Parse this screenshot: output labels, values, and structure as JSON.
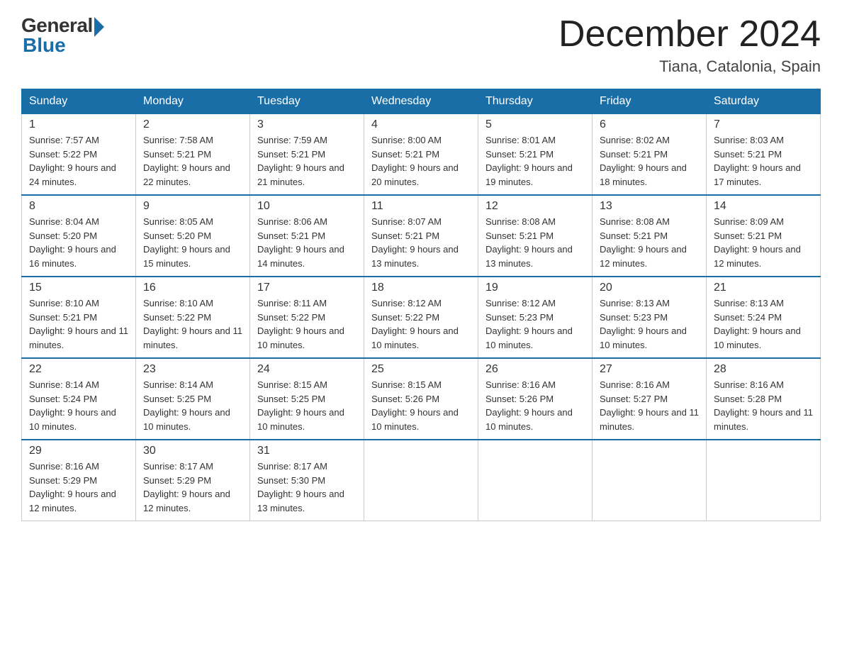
{
  "header": {
    "logo_general": "General",
    "logo_blue": "Blue",
    "month_title": "December 2024",
    "location": "Tiana, Catalonia, Spain"
  },
  "calendar": {
    "days_of_week": [
      "Sunday",
      "Monday",
      "Tuesday",
      "Wednesday",
      "Thursday",
      "Friday",
      "Saturday"
    ],
    "weeks": [
      [
        {
          "day": "1",
          "sunrise": "Sunrise: 7:57 AM",
          "sunset": "Sunset: 5:22 PM",
          "daylight": "Daylight: 9 hours and 24 minutes."
        },
        {
          "day": "2",
          "sunrise": "Sunrise: 7:58 AM",
          "sunset": "Sunset: 5:21 PM",
          "daylight": "Daylight: 9 hours and 22 minutes."
        },
        {
          "day": "3",
          "sunrise": "Sunrise: 7:59 AM",
          "sunset": "Sunset: 5:21 PM",
          "daylight": "Daylight: 9 hours and 21 minutes."
        },
        {
          "day": "4",
          "sunrise": "Sunrise: 8:00 AM",
          "sunset": "Sunset: 5:21 PM",
          "daylight": "Daylight: 9 hours and 20 minutes."
        },
        {
          "day": "5",
          "sunrise": "Sunrise: 8:01 AM",
          "sunset": "Sunset: 5:21 PM",
          "daylight": "Daylight: 9 hours and 19 minutes."
        },
        {
          "day": "6",
          "sunrise": "Sunrise: 8:02 AM",
          "sunset": "Sunset: 5:21 PM",
          "daylight": "Daylight: 9 hours and 18 minutes."
        },
        {
          "day": "7",
          "sunrise": "Sunrise: 8:03 AM",
          "sunset": "Sunset: 5:21 PM",
          "daylight": "Daylight: 9 hours and 17 minutes."
        }
      ],
      [
        {
          "day": "8",
          "sunrise": "Sunrise: 8:04 AM",
          "sunset": "Sunset: 5:20 PM",
          "daylight": "Daylight: 9 hours and 16 minutes."
        },
        {
          "day": "9",
          "sunrise": "Sunrise: 8:05 AM",
          "sunset": "Sunset: 5:20 PM",
          "daylight": "Daylight: 9 hours and 15 minutes."
        },
        {
          "day": "10",
          "sunrise": "Sunrise: 8:06 AM",
          "sunset": "Sunset: 5:21 PM",
          "daylight": "Daylight: 9 hours and 14 minutes."
        },
        {
          "day": "11",
          "sunrise": "Sunrise: 8:07 AM",
          "sunset": "Sunset: 5:21 PM",
          "daylight": "Daylight: 9 hours and 13 minutes."
        },
        {
          "day": "12",
          "sunrise": "Sunrise: 8:08 AM",
          "sunset": "Sunset: 5:21 PM",
          "daylight": "Daylight: 9 hours and 13 minutes."
        },
        {
          "day": "13",
          "sunrise": "Sunrise: 8:08 AM",
          "sunset": "Sunset: 5:21 PM",
          "daylight": "Daylight: 9 hours and 12 minutes."
        },
        {
          "day": "14",
          "sunrise": "Sunrise: 8:09 AM",
          "sunset": "Sunset: 5:21 PM",
          "daylight": "Daylight: 9 hours and 12 minutes."
        }
      ],
      [
        {
          "day": "15",
          "sunrise": "Sunrise: 8:10 AM",
          "sunset": "Sunset: 5:21 PM",
          "daylight": "Daylight: 9 hours and 11 minutes."
        },
        {
          "day": "16",
          "sunrise": "Sunrise: 8:10 AM",
          "sunset": "Sunset: 5:22 PM",
          "daylight": "Daylight: 9 hours and 11 minutes."
        },
        {
          "day": "17",
          "sunrise": "Sunrise: 8:11 AM",
          "sunset": "Sunset: 5:22 PM",
          "daylight": "Daylight: 9 hours and 10 minutes."
        },
        {
          "day": "18",
          "sunrise": "Sunrise: 8:12 AM",
          "sunset": "Sunset: 5:22 PM",
          "daylight": "Daylight: 9 hours and 10 minutes."
        },
        {
          "day": "19",
          "sunrise": "Sunrise: 8:12 AM",
          "sunset": "Sunset: 5:23 PM",
          "daylight": "Daylight: 9 hours and 10 minutes."
        },
        {
          "day": "20",
          "sunrise": "Sunrise: 8:13 AM",
          "sunset": "Sunset: 5:23 PM",
          "daylight": "Daylight: 9 hours and 10 minutes."
        },
        {
          "day": "21",
          "sunrise": "Sunrise: 8:13 AM",
          "sunset": "Sunset: 5:24 PM",
          "daylight": "Daylight: 9 hours and 10 minutes."
        }
      ],
      [
        {
          "day": "22",
          "sunrise": "Sunrise: 8:14 AM",
          "sunset": "Sunset: 5:24 PM",
          "daylight": "Daylight: 9 hours and 10 minutes."
        },
        {
          "day": "23",
          "sunrise": "Sunrise: 8:14 AM",
          "sunset": "Sunset: 5:25 PM",
          "daylight": "Daylight: 9 hours and 10 minutes."
        },
        {
          "day": "24",
          "sunrise": "Sunrise: 8:15 AM",
          "sunset": "Sunset: 5:25 PM",
          "daylight": "Daylight: 9 hours and 10 minutes."
        },
        {
          "day": "25",
          "sunrise": "Sunrise: 8:15 AM",
          "sunset": "Sunset: 5:26 PM",
          "daylight": "Daylight: 9 hours and 10 minutes."
        },
        {
          "day": "26",
          "sunrise": "Sunrise: 8:16 AM",
          "sunset": "Sunset: 5:26 PM",
          "daylight": "Daylight: 9 hours and 10 minutes."
        },
        {
          "day": "27",
          "sunrise": "Sunrise: 8:16 AM",
          "sunset": "Sunset: 5:27 PM",
          "daylight": "Daylight: 9 hours and 11 minutes."
        },
        {
          "day": "28",
          "sunrise": "Sunrise: 8:16 AM",
          "sunset": "Sunset: 5:28 PM",
          "daylight": "Daylight: 9 hours and 11 minutes."
        }
      ],
      [
        {
          "day": "29",
          "sunrise": "Sunrise: 8:16 AM",
          "sunset": "Sunset: 5:29 PM",
          "daylight": "Daylight: 9 hours and 12 minutes."
        },
        {
          "day": "30",
          "sunrise": "Sunrise: 8:17 AM",
          "sunset": "Sunset: 5:29 PM",
          "daylight": "Daylight: 9 hours and 12 minutes."
        },
        {
          "day": "31",
          "sunrise": "Sunrise: 8:17 AM",
          "sunset": "Sunset: 5:30 PM",
          "daylight": "Daylight: 9 hours and 13 minutes."
        },
        null,
        null,
        null,
        null
      ]
    ]
  }
}
